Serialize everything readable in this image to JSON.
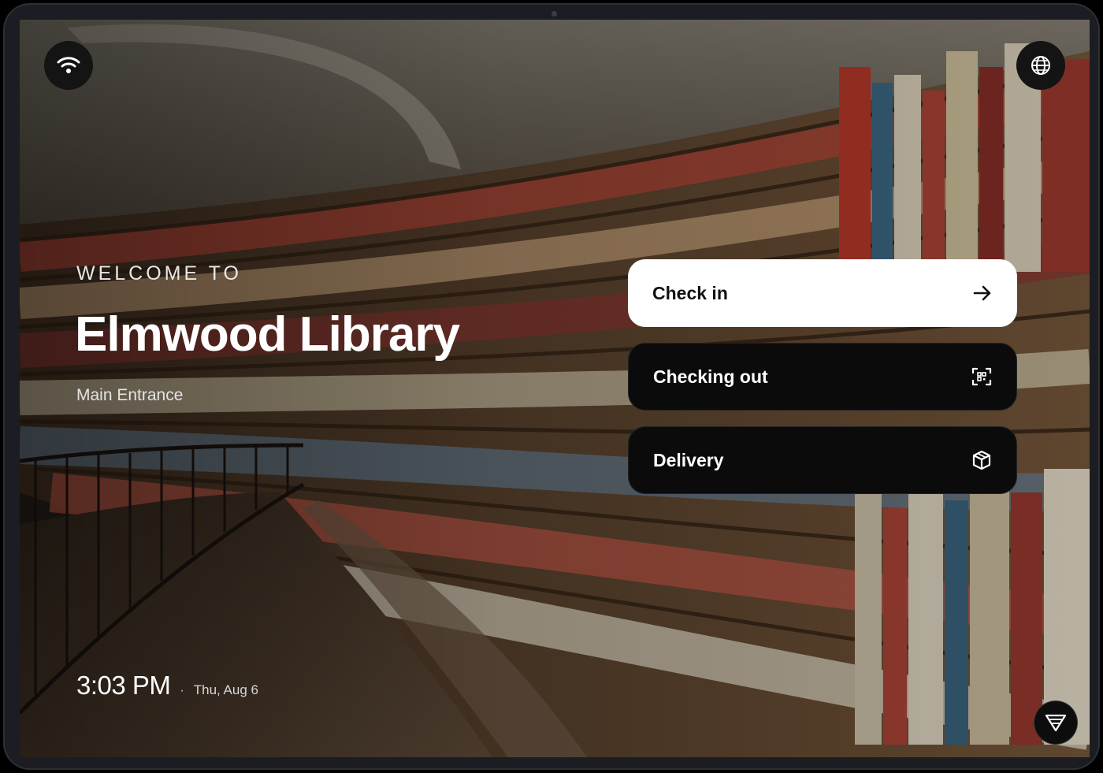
{
  "kiosk": {
    "eyebrow": "WELCOME TO",
    "title": "Elmwood Library",
    "subtitle": "Main Entrance"
  },
  "clock": {
    "time": "3:03 PM",
    "separator": "·",
    "date": "Thu, Aug 6"
  },
  "actions": [
    {
      "label": "Check in",
      "icon": "arrow-right-icon",
      "style": "primary"
    },
    {
      "label": "Checking out",
      "icon": "qr-scan-icon",
      "style": "dark"
    },
    {
      "label": "Delivery",
      "icon": "package-icon",
      "style": "dark"
    }
  ],
  "top_icons": {
    "left": "wifi-icon",
    "right": "globe-icon"
  },
  "corner_icon": "brand-logo-icon",
  "colors": {
    "primary_button_bg": "#ffffff",
    "dark_button_bg": "#0b0b0b",
    "text_light": "#ffffff"
  }
}
